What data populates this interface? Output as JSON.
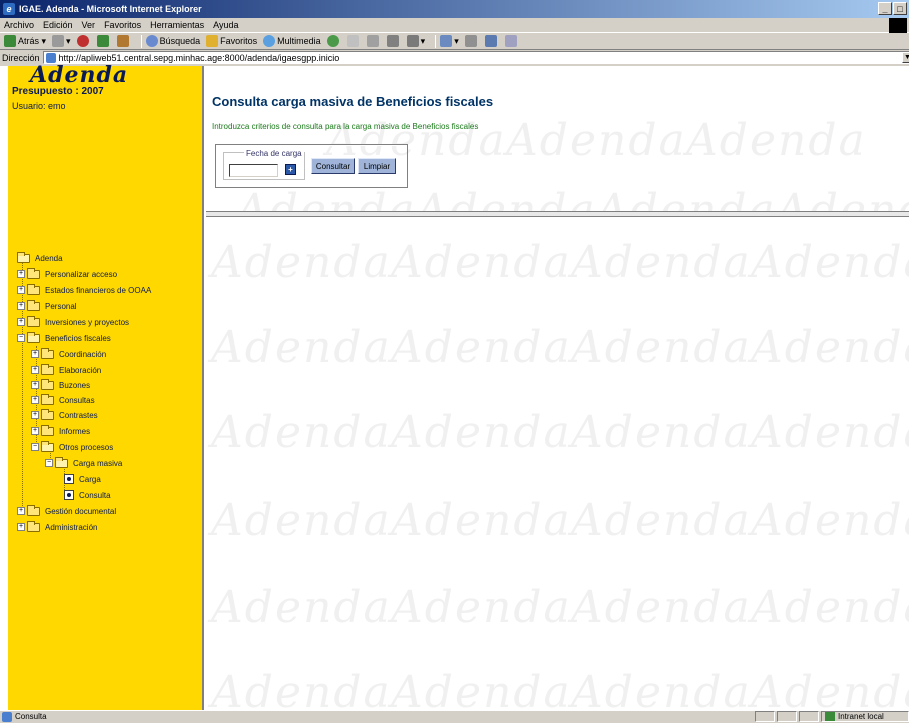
{
  "window": {
    "title": "IGAE. Adenda - Microsoft Internet Explorer"
  },
  "menu": [
    "Archivo",
    "Edición",
    "Ver",
    "Favoritos",
    "Herramientas",
    "Ayuda"
  ],
  "toolbar": {
    "back": "Atrás",
    "search": "Búsqueda",
    "favorites": "Favoritos",
    "multimedia": "Multimedia"
  },
  "address": {
    "label": "Dirección",
    "url": "http://apliweb51.central.sepg.minhac.age:8000/adenda/igaesgpp.inicio"
  },
  "sidebar": {
    "logo": "Adenda",
    "budget": "Presupuesto : 2007",
    "user": "Usuario: emo",
    "tree": [
      "Adenda",
      "Personalizar acceso",
      "Estados financieros de OOAA",
      "Personal",
      "Inversiones y proyectos",
      "Beneficios fiscales",
      "Coordinación",
      "Elaboración",
      "Buzones",
      "Consultas",
      "Contrastes",
      "Informes",
      "Otros procesos",
      "Carga masiva",
      "Carga",
      "Consulta",
      "Gestión documental",
      "Administración"
    ]
  },
  "main": {
    "title": "Consulta carga masiva de Beneficios fiscales",
    "subtitle": "Introduzca criterios de consulta para la carga masiva de Beneficios fiscales",
    "date_label": "Fecha de carga",
    "date_value": "",
    "consult_button": "Consultar",
    "clear_button": "Limpiar",
    "watermark": "Adenda"
  },
  "status": {
    "text": "Consulta",
    "zone": "Intranet local"
  }
}
